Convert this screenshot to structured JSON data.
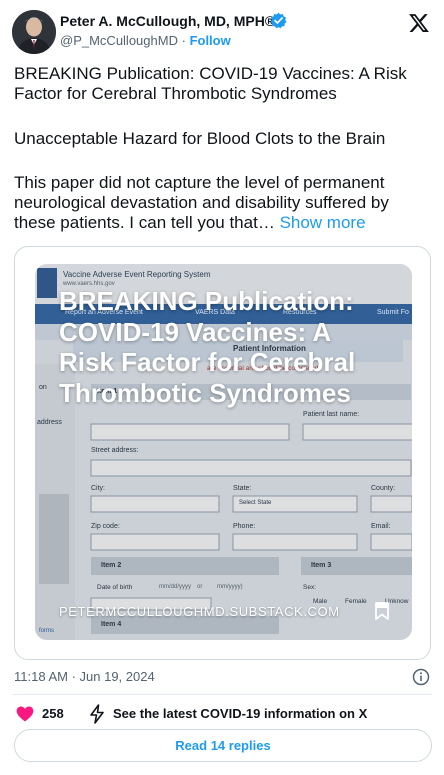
{
  "author": {
    "name": "Peter A. McCullough, MD, MPH®",
    "handle": "@P_McCulloughMD",
    "separator": "·",
    "follow_label": "Follow"
  },
  "tweet": {
    "line1": "BREAKING Publication: COVID-19 Vaccines: A Risk Factor for Cerebral Thrombotic Syndromes",
    "line2": "Unacceptable Hazard for Blood Clots to the Brain",
    "line3": "This paper did not capture the level of permanent neurological devastation and disability suffered by these patients. I can tell you that…",
    "show_more": "Show more"
  },
  "card": {
    "overlay_title": "BREAKING Publication: COVID-19 Vaccines: A Risk Factor for Cerebral Thrombotic Syndromes",
    "domain": "PETERMCCULLOUGHMD.SUBSTACK.COM",
    "bg": {
      "site_title": "Vaccine Adverse Event Reporting System",
      "site_url": "www.vaers.hhs.gov",
      "nav": [
        "Report an Adverse Event",
        "VAERS Data",
        "Resources",
        "Submit Fo"
      ],
      "section": "Patient Information",
      "note": "are essential and should be completed.",
      "item1": "Item 1",
      "patient_last_name": "Patient last name:",
      "street_address": "Street address:",
      "city": "City:",
      "state": "State:",
      "county": "County:",
      "select_state": "Select State",
      "zip": "Zip code:",
      "phone": "Phone:",
      "email": "Email:",
      "item2": "Item 2",
      "item3": "Item 3",
      "dob": "Date of birth",
      "dob_fmt": "mm/dd/yyyy",
      "or": "or",
      "dob_fmt2": "mm/yyyy)",
      "sex": "Sex:",
      "male": "Male",
      "female": "Female",
      "unknown": "Unknow",
      "item4": "Item 4",
      "forms": "forms",
      "side1": "on",
      "side2": "address"
    }
  },
  "meta": {
    "time": "11:18 AM · Jun 19, 2024"
  },
  "actions": {
    "likes": "258",
    "latest": "See the latest COVID-19 information on X",
    "replies": "Read 14 replies"
  },
  "colors": {
    "accent": "#1d9bf0",
    "like": "#f91880",
    "text": "#0f1419",
    "muted": "#536471"
  }
}
